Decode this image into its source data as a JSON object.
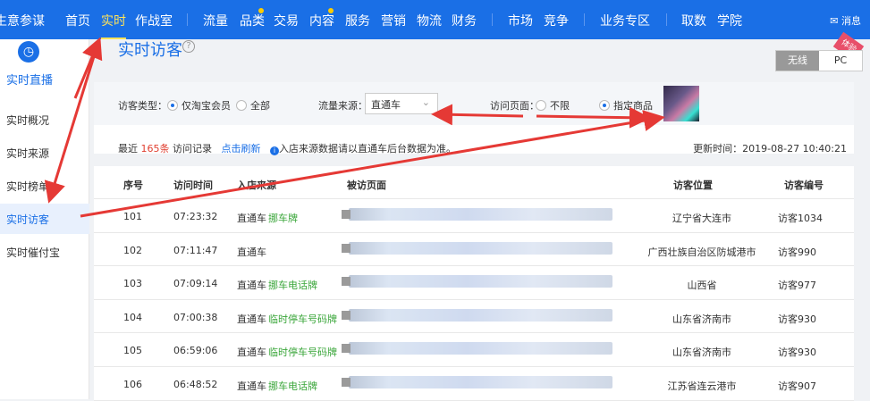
{
  "nav": {
    "brand": "生意参谋",
    "items": [
      "首页",
      "实时",
      "作战室",
      "流量",
      "品类",
      "交易",
      "内容",
      "服务",
      "营销",
      "物流",
      "财务",
      "市场",
      "竞争",
      "业务专区",
      "取数",
      "学院"
    ],
    "message": "消息"
  },
  "sidebar": {
    "header": "实时直播",
    "items": [
      "实时概况",
      "实时来源",
      "实时榜单",
      "实时访客",
      "实时催付宝"
    ]
  },
  "page": {
    "title": "实时访客",
    "toggle": [
      "无线",
      "PC"
    ],
    "ribbon": "体验"
  },
  "filters": {
    "visitor_type_label": "访客类型：",
    "visitor_options": [
      "仅淘宝会员",
      "全部"
    ],
    "traffic_source_label": "流量来源：",
    "traffic_source_value": "直通车",
    "visit_page_label": "访问页面：",
    "visit_page_options": [
      "不限",
      "指定商品"
    ]
  },
  "records": {
    "prefix": "最近",
    "count": "165条",
    "suffix": "访问记录",
    "refresh": "点击刷新",
    "note": "入店来源数据请以直通车后台数据为准。",
    "updated": "更新时间：2019-08-27 10:40:21"
  },
  "table": {
    "headers": [
      "序号",
      "访问时间",
      "入店来源",
      "被访页面",
      "访客位置",
      "访客编号"
    ],
    "rows": [
      {
        "seq": "101",
        "time": "07:23:32",
        "source": "直通车",
        "keyword": "挪车牌",
        "location": "辽宁省大连市",
        "visitor": "访客1034"
      },
      {
        "seq": "102",
        "time": "07:11:47",
        "source": "直通车",
        "keyword": "",
        "location": "广西壮族自治区防城港市",
        "visitor": "访客990"
      },
      {
        "seq": "103",
        "time": "07:09:14",
        "source": "直通车",
        "keyword": "挪车电话牌",
        "location": "山西省",
        "visitor": "访客977"
      },
      {
        "seq": "104",
        "time": "07:00:38",
        "source": "直通车",
        "keyword": "临时停车号码牌",
        "location": "山东省济南市",
        "visitor": "访客930"
      },
      {
        "seq": "105",
        "time": "06:59:06",
        "source": "直通车",
        "keyword": "临时停车号码牌",
        "location": "山东省济南市",
        "visitor": "访客930"
      },
      {
        "seq": "106",
        "time": "06:48:52",
        "source": "直通车",
        "keyword": "挪车电话牌",
        "location": "江苏省连云港市",
        "visitor": "访客907"
      }
    ]
  },
  "colors": {
    "primary": "#1a6fe6",
    "annotation": "#e53935",
    "keyword": "#3aa63a"
  }
}
